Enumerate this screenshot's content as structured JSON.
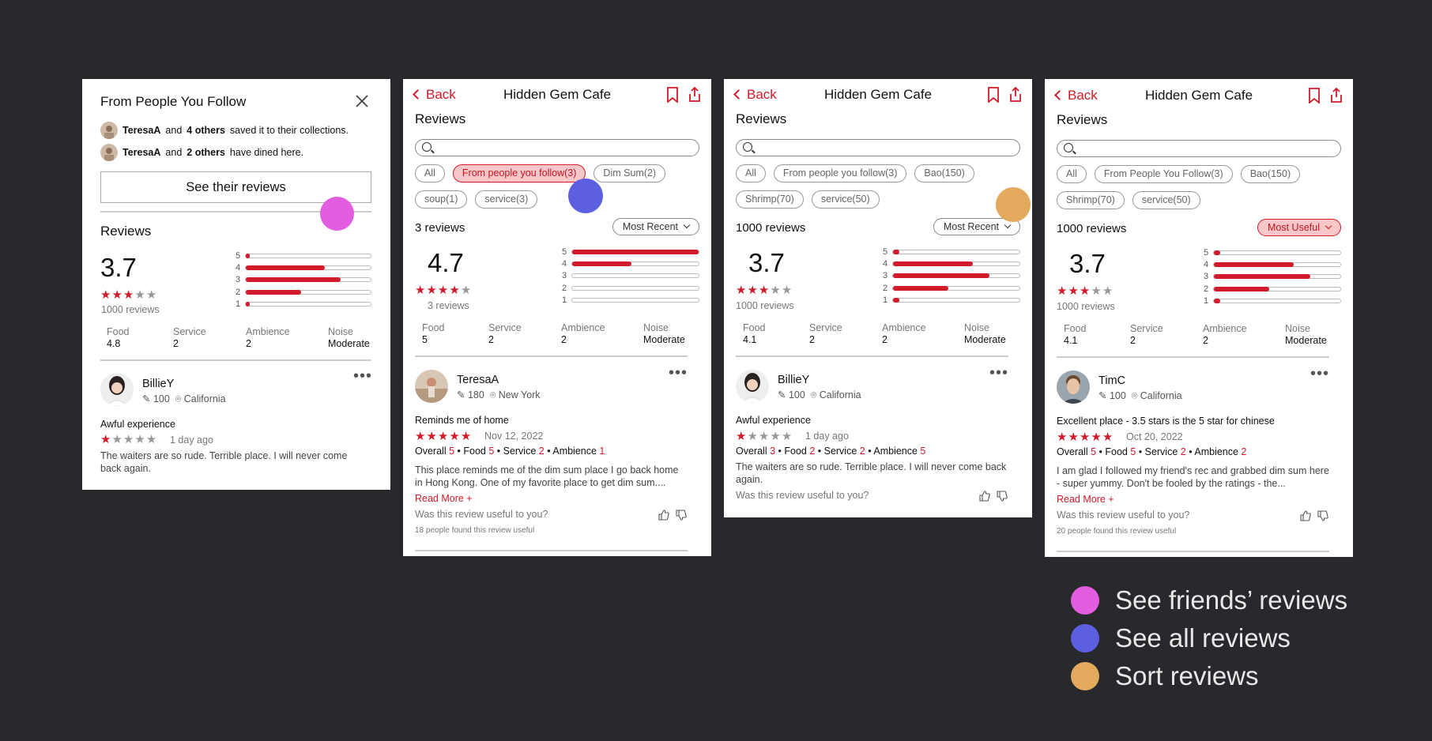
{
  "panel1": {
    "title": "From People You Follow",
    "line1": {
      "user": "TeresaA",
      "and": "and",
      "others": "4 others",
      "rest": "saved it to their collections."
    },
    "line2": {
      "user": "TeresaA",
      "and": "and",
      "others": "2 others",
      "rest": "have dined here."
    },
    "button": "See their reviews",
    "reviews_label": "Reviews",
    "rating": "3.7",
    "stars_filled": 3,
    "review_count": "1000 reviews",
    "bars": [
      {
        "label": "5",
        "fill": 0.03
      },
      {
        "label": "4",
        "fill": 0.63
      },
      {
        "label": "3",
        "fill": 0.76
      },
      {
        "label": "2",
        "fill": 0.44
      },
      {
        "label": "1",
        "fill": 0.03
      }
    ],
    "cats": [
      {
        "k": "Food",
        "v": "4.8"
      },
      {
        "k": "Service",
        "v": "2"
      },
      {
        "k": "Ambience",
        "v": "2"
      },
      {
        "k": "Noise",
        "v": "Moderate"
      }
    ],
    "review": {
      "user": "BillieY",
      "edits": "100",
      "loc": "California",
      "title": "Awful experience",
      "stars_filled": 1,
      "date": "1 day ago",
      "body": "The waiters are so rude. Terrible place. I will never come back again."
    }
  },
  "panel2": {
    "back": "Back",
    "title": "Hidden Gem Cafe",
    "reviews_label": "Reviews",
    "chips": [
      {
        "label": "All",
        "on": false
      },
      {
        "label": "From people you follow(3)",
        "on": true
      },
      {
        "label": "Dim Sum(2)",
        "on": false
      },
      {
        "label": "soup(1)",
        "on": false
      },
      {
        "label": "service(3)",
        "on": false
      }
    ],
    "count": "3 reviews",
    "sort": "Most Recent",
    "rating": "4.7",
    "stars_filled": 4,
    "review_count": "3 reviews",
    "bars": [
      {
        "label": "5",
        "fill": 1.0
      },
      {
        "label": "4",
        "fill": 0.47
      },
      {
        "label": "3",
        "fill": 0
      },
      {
        "label": "2",
        "fill": 0
      },
      {
        "label": "1",
        "fill": 0
      }
    ],
    "cats": [
      {
        "k": "Food",
        "v": "5"
      },
      {
        "k": "Service",
        "v": "2"
      },
      {
        "k": "Ambience",
        "v": "2"
      },
      {
        "k": "Noise",
        "v": "Moderate"
      }
    ],
    "review": {
      "user": "TeresaA",
      "edits": "180",
      "loc": "New York",
      "title": "Reminds me of home",
      "stars_filled": 5,
      "date": "Nov 12, 2022",
      "scores": [
        {
          "k": "Overall",
          "v": "5"
        },
        {
          "k": "Food",
          "v": "5"
        },
        {
          "k": "Service",
          "v": "2"
        },
        {
          "k": "Ambience",
          "v": "1"
        }
      ],
      "body": "This place reminds me of the dim sum place I go back home in Hong Kong. One of my favorite place to get dim sum....",
      "read_more": "Read More +",
      "useful_q": "Was this review useful to you?",
      "found": "18 people found this review useful"
    }
  },
  "panel3": {
    "back": "Back",
    "title": "Hidden Gem Cafe",
    "reviews_label": "Reviews",
    "chips": [
      {
        "label": "All",
        "on": false
      },
      {
        "label": "From people you follow(3)",
        "on": false
      },
      {
        "label": "Bao(150)",
        "on": false
      },
      {
        "label": "Shrimp(70)",
        "on": false
      },
      {
        "label": "service(50)",
        "on": false
      }
    ],
    "count": "1000 reviews",
    "sort": "Most Recent",
    "rating": "3.7",
    "stars_filled": 3,
    "review_count": "1000 reviews",
    "bars": [
      {
        "label": "5",
        "fill": 0.05
      },
      {
        "label": "4",
        "fill": 0.63
      },
      {
        "label": "3",
        "fill": 0.76
      },
      {
        "label": "2",
        "fill": 0.44
      },
      {
        "label": "1",
        "fill": 0.05
      }
    ],
    "cats": [
      {
        "k": "Food",
        "v": "4.1"
      },
      {
        "k": "Service",
        "v": "2"
      },
      {
        "k": "Ambience",
        "v": "2"
      },
      {
        "k": "Noise",
        "v": "Moderate"
      }
    ],
    "review": {
      "user": "BillieY",
      "edits": "100",
      "loc": "California",
      "title": "Awful experience",
      "stars_filled": 1,
      "date": "1 day ago",
      "scores": [
        {
          "k": "Overall",
          "v": "3"
        },
        {
          "k": "Food",
          "v": "2"
        },
        {
          "k": "Service",
          "v": "2"
        },
        {
          "k": "Ambience",
          "v": "5"
        }
      ],
      "body": "The waiters are so rude. Terrible place. I will never come back again.",
      "useful_q": "Was this review useful to you?"
    }
  },
  "panel4": {
    "back": "Back",
    "title": "Hidden Gem Cafe",
    "reviews_label": "Reviews",
    "chips": [
      {
        "label": "All",
        "on": false
      },
      {
        "label": "From People You Follow(3)",
        "on": false
      },
      {
        "label": "Bao(150)",
        "on": false
      },
      {
        "label": "Shrimp(70)",
        "on": false
      },
      {
        "label": "service(50)",
        "on": false
      }
    ],
    "count": "1000 reviews",
    "sort": "Most Useful",
    "rating": "3.7",
    "stars_filled": 3,
    "review_count": "1000 reviews",
    "bars": [
      {
        "label": "5",
        "fill": 0.05
      },
      {
        "label": "4",
        "fill": 0.63
      },
      {
        "label": "3",
        "fill": 0.76
      },
      {
        "label": "2",
        "fill": 0.44
      },
      {
        "label": "1",
        "fill": 0.05
      }
    ],
    "cats": [
      {
        "k": "Food",
        "v": "4.1"
      },
      {
        "k": "Service",
        "v": "2"
      },
      {
        "k": "Ambience",
        "v": "2"
      },
      {
        "k": "Noise",
        "v": "Moderate"
      }
    ],
    "review": {
      "user": "TimC",
      "edits": "100",
      "loc": "California",
      "title": "Excellent place - 3.5 stars is the 5 star for chinese",
      "stars_filled": 5,
      "date": "Oct 20, 2022",
      "scores": [
        {
          "k": "Overall",
          "v": "5"
        },
        {
          "k": "Food",
          "v": "5"
        },
        {
          "k": "Service",
          "v": "2"
        },
        {
          "k": "Ambience",
          "v": "2"
        }
      ],
      "body": "I am glad I followed my friend's rec and grabbed dim sum here - super yummy. Don't be fooled by the ratings - the...",
      "read_more": "Read More +",
      "useful_q": "Was this review useful to you?",
      "found": "20 people found this review useful"
    }
  },
  "legend": [
    {
      "label": "See friends’ reviews",
      "color": "#e35de0"
    },
    {
      "label": "See all reviews",
      "color": "#5d5fe3"
    },
    {
      "label": "Sort reviews",
      "color": "#e3aa5d"
    }
  ],
  "colors": {
    "accent": "#d11a2a",
    "background": "#28292d"
  }
}
